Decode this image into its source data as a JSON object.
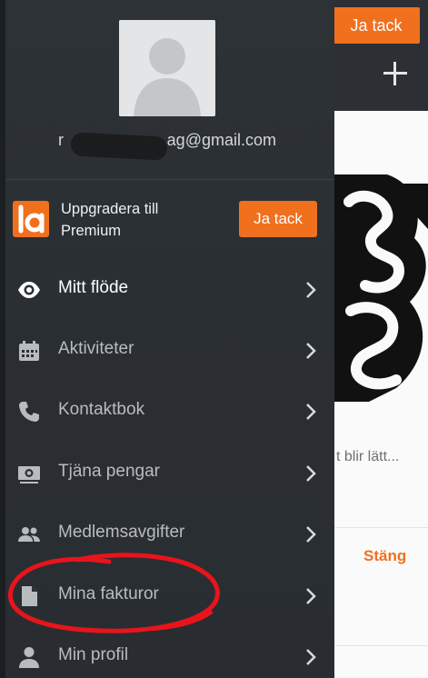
{
  "background_app": {
    "top_button_label": "Ja tack",
    "teaser_text": "t blir lätt...",
    "close_label": "Stäng"
  },
  "drawer": {
    "profile": {
      "email_visible_prefix": "r",
      "email_visible_suffix": "ag@gmail.com"
    },
    "premium": {
      "text_line1": "Uppgradera till",
      "text_line2": "Premium",
      "button_label": "Ja tack"
    },
    "menu_items": [
      {
        "label": "Mitt flöde",
        "icon": "eye-icon",
        "active": true
      },
      {
        "label": "Aktiviteter",
        "icon": "calendar-icon",
        "active": false
      },
      {
        "label": "Kontaktbok",
        "icon": "phone-icon",
        "active": false
      },
      {
        "label": "Tjäna pengar",
        "icon": "money-icon",
        "active": false
      },
      {
        "label": "Medlemsavgifter",
        "icon": "group-icon",
        "active": false
      },
      {
        "label": "Mina fakturor",
        "icon": "document-icon",
        "active": false
      },
      {
        "label": "Min profil",
        "icon": "person-icon",
        "active": false
      }
    ]
  },
  "colors": {
    "accent": "#f0701e",
    "drawer_bg": "#2b3034",
    "annotation_red": "#e8141c"
  }
}
